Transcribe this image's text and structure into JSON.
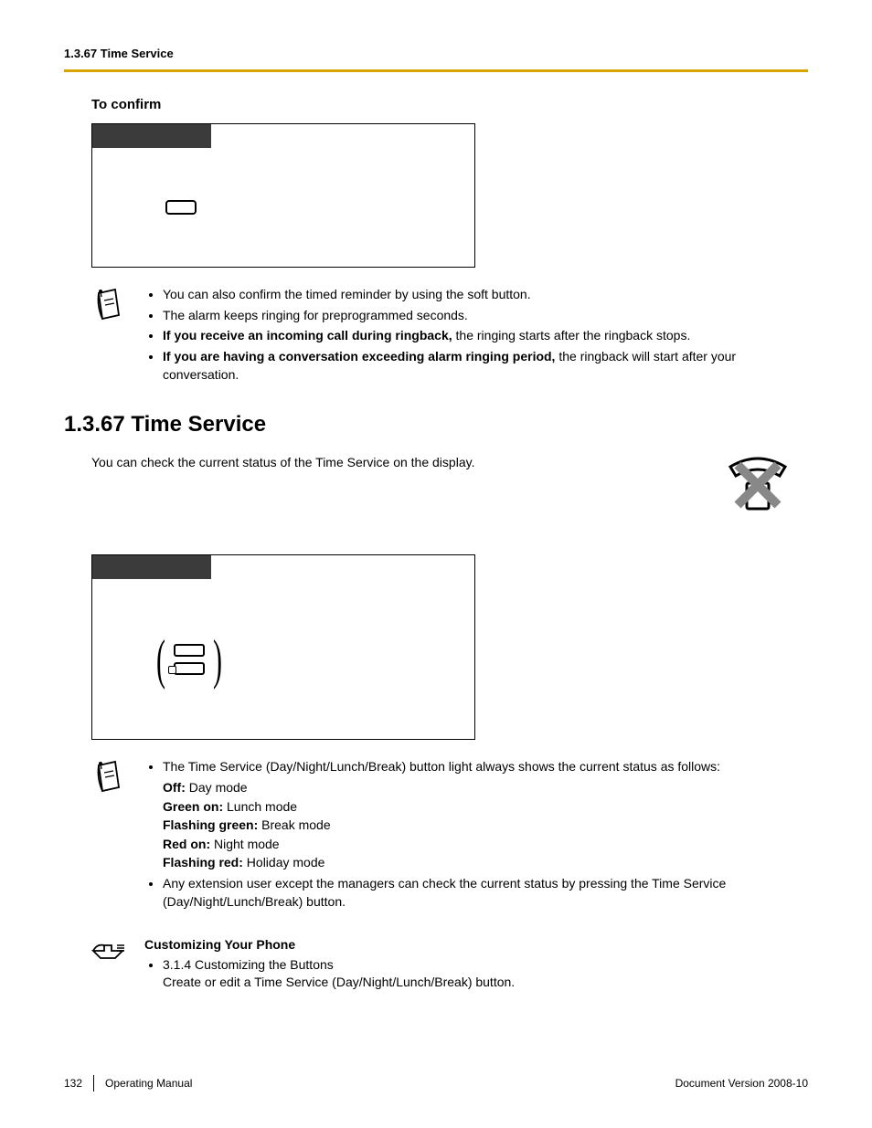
{
  "header": "1.3.67 Time Service",
  "section_confirm": {
    "heading": "To confirm"
  },
  "notes1": {
    "items": [
      "You can also confirm the timed reminder by using the soft button.",
      "The alarm keeps ringing for preprogrammed seconds."
    ],
    "bold3_prefix": "If you receive an incoming call during ringback,",
    "bold3_rest": " the ringing starts after the ringback stops.",
    "bold4_prefix": "If you are having a conversation exceeding alarm ringing period,",
    "bold4_rest": " the ringback will start after your conversation."
  },
  "section_title": "1.3.67  Time Service",
  "intro": "You can check the current status of the Time Service on the display.",
  "notes2": {
    "lead": "The Time Service (Day/Night/Lunch/Break) button light always shows the current status as follows:",
    "statuses": {
      "off_label": "Off:",
      "off_val": " Day mode",
      "green_label": "Green on:",
      "green_val": " Lunch mode",
      "fgreen_label": "Flashing green:",
      "fgreen_val": " Break mode",
      "red_label": "Red on:",
      "red_val": " Night mode",
      "fred_label": "Flashing red:",
      "fred_val": " Holiday mode"
    },
    "item2": "Any extension user except the managers can check the current status by pressing the Time Service (Day/Night/Lunch/Break) button."
  },
  "customize": {
    "heading": "Customizing Your Phone",
    "item_ref": "3.1.4  Customizing the Buttons",
    "item_desc": "Create or edit a Time Service (Day/Night/Lunch/Break) button."
  },
  "footer": {
    "page": "132",
    "manual": "Operating Manual",
    "version": "Document Version  2008-10"
  }
}
